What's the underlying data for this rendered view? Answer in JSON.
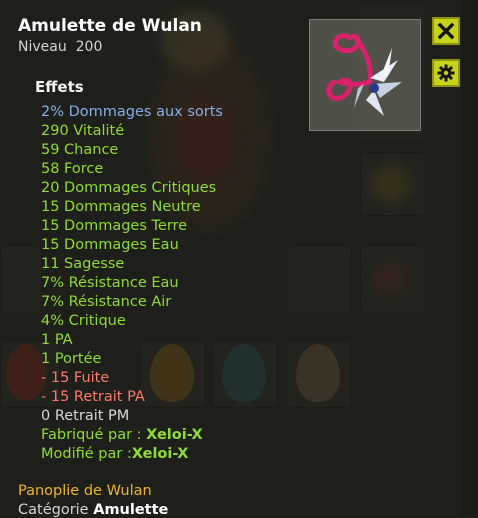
{
  "item": {
    "name": "Amulette de Wulan",
    "level_label": "Niveau",
    "level_value": "200"
  },
  "effects": {
    "heading": "Effets",
    "lines": [
      {
        "text": "2% Dommages aux sorts",
        "color": "blue"
      },
      {
        "text": "290 Vitalité",
        "color": "green"
      },
      {
        "text": "59 Chance",
        "color": "green"
      },
      {
        "text": "58 Force",
        "color": "green"
      },
      {
        "text": "20 Dommages Critiques",
        "color": "green"
      },
      {
        "text": "15 Dommages Neutre",
        "color": "green"
      },
      {
        "text": "15 Dommages Terre",
        "color": "green"
      },
      {
        "text": "15 Dommages Eau",
        "color": "green"
      },
      {
        "text": "11 Sagesse",
        "color": "green"
      },
      {
        "text": "7% Résistance Eau",
        "color": "green"
      },
      {
        "text": "7% Résistance Air",
        "color": "green"
      },
      {
        "text": "4% Critique",
        "color": "green"
      },
      {
        "text": "1 PA",
        "color": "green"
      },
      {
        "text": "1 Portée",
        "color": "green"
      },
      {
        "text": "- 15 Fuite",
        "color": "red"
      },
      {
        "text": "- 15 Retrait PA",
        "color": "red"
      },
      {
        "text": "0 Retrait PM",
        "color": "grey"
      }
    ],
    "crafted_label": "Fabriqué par :",
    "crafted_by": "Xeloi-X",
    "modified_label": "Modifié par :",
    "modified_by": "Xeloi-X"
  },
  "set": {
    "name": "Panoplie de Wulan",
    "category_label": "Catégorie",
    "category_value": "Amulette"
  },
  "buttons": {
    "close_icon": "close-icon",
    "settings_icon": "gear-icon"
  },
  "colors": {
    "blue": "#86aee8",
    "green": "#8fdc34",
    "red": "#ff7a6a",
    "grey": "#d8d8d2",
    "set": "#f0b42a",
    "button": "#c9d21a"
  }
}
